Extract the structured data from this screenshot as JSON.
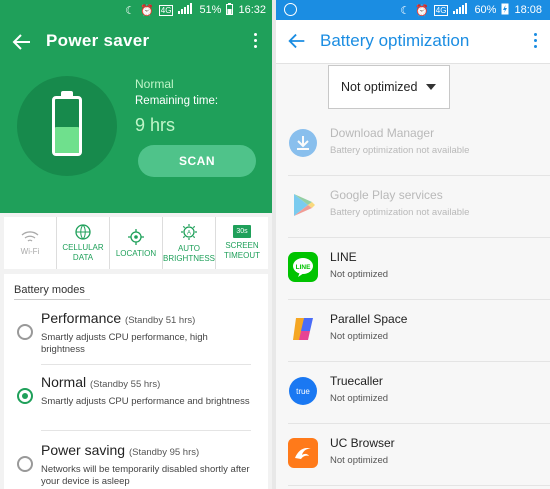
{
  "left": {
    "status_bar": {
      "battery": "51%",
      "time": "16:32",
      "network": "4G"
    },
    "title": "Power saver",
    "current_mode": "Normal",
    "remaining_label": "Remaining time:",
    "remaining_value": "9 hrs",
    "battery_level": 0.45,
    "scan_label": "SCAN",
    "quick_settings": [
      {
        "label": "Wi-Fi",
        "icon": "wifi-icon",
        "active": false
      },
      {
        "label": "CELLULAR DATA",
        "icon": "cellular-data-icon",
        "active": true
      },
      {
        "label": "LOCATION",
        "icon": "location-icon",
        "active": true
      },
      {
        "label": "AUTO BRIGHTNESS",
        "icon": "auto-brightness-icon",
        "active": true
      },
      {
        "label": "SCREEN TIMEOUT",
        "icon": "screen-timeout-icon",
        "icon_text": "30s",
        "active": true
      }
    ],
    "modes_header": "Battery modes",
    "modes": [
      {
        "name": "Performance",
        "standby": "(Standby 51 hrs)",
        "desc": "Smartly adjusts CPU performance, high brightness",
        "selected": false
      },
      {
        "name": "Normal",
        "standby": "(Standby 55 hrs)",
        "desc": "Smartly adjusts CPU performance and brightness",
        "selected": true
      },
      {
        "name": "Power saving",
        "standby": "(Standby 95 hrs)",
        "desc": "Networks will be temporarily disabled shortly after your device is asleep",
        "selected": false
      }
    ],
    "colors": {
      "primary": "#1fa05a",
      "accent_light": "#bff5c8",
      "battery_fill": "#6fe08d"
    }
  },
  "right": {
    "status_bar": {
      "battery": "60%",
      "time": "18:08",
      "network": "4G"
    },
    "title": "Battery optimization",
    "filter_label": "Not optimized",
    "apps": [
      {
        "name": "Download Manager",
        "status": "Battery optimization not available",
        "icon": "download-manager-icon",
        "dimmed": true
      },
      {
        "name": "Google Play services",
        "status": "Battery optimization not available",
        "icon": "google-play-services-icon",
        "dimmed": true
      },
      {
        "name": "LINE",
        "status": "Not optimized",
        "icon": "line-app-icon",
        "dimmed": false
      },
      {
        "name": "Parallel Space",
        "status": "Not optimized",
        "icon": "parallel-space-icon",
        "dimmed": false
      },
      {
        "name": "Truecaller",
        "status": "Not optimized",
        "icon": "truecaller-icon",
        "icon_text": "true",
        "dimmed": false
      },
      {
        "name": "UC Browser",
        "status": "Not optimized",
        "icon": "uc-browser-icon",
        "dimmed": false
      }
    ],
    "colors": {
      "primary": "#1b8de2"
    }
  }
}
